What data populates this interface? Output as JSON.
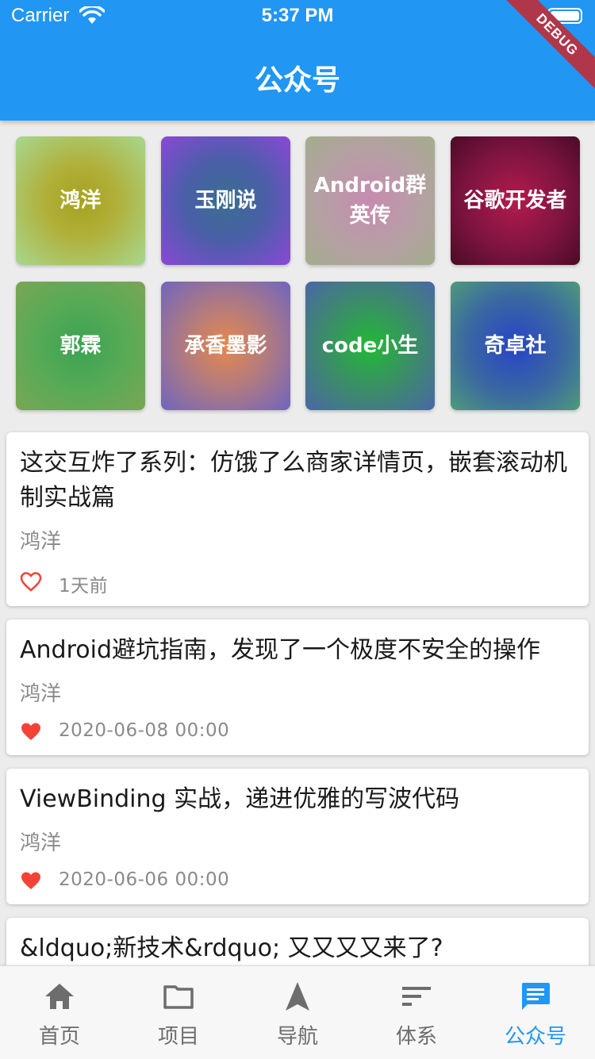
{
  "status_bar": {
    "carrier": "Carrier",
    "time": "5:37 PM",
    "debug_banner": "DEBUG"
  },
  "app_bar": {
    "title": "公众号"
  },
  "accounts": [
    {
      "name": "鸿洋"
    },
    {
      "name": "玉刚说"
    },
    {
      "name": "Android群英传"
    },
    {
      "name": "谷歌开发者"
    },
    {
      "name": "郭霖"
    },
    {
      "name": "承香墨影"
    },
    {
      "name": "code小生"
    },
    {
      "name": "奇卓社"
    }
  ],
  "articles": [
    {
      "title": "这交互炸了系列：仿饿了么商家详情页，嵌套滚动机制实战篇",
      "author": "鸿洋",
      "time": "1天前",
      "liked": false
    },
    {
      "title": "Android避坑指南，发现了一个极度不安全的操作",
      "author": "鸿洋",
      "time": "2020-06-08 00:00",
      "liked": true
    },
    {
      "title": "ViewBinding 实战，递进优雅的写波代码",
      "author": "鸿洋",
      "time": "2020-06-06 00:00",
      "liked": true
    },
    {
      "title": "&ldquo;新技术&rdquo; 又又又又来了?",
      "author": "",
      "time": "",
      "liked": false
    }
  ],
  "bottom_nav": {
    "active": "公众号",
    "items": [
      {
        "label": "首页",
        "icon": "home-icon"
      },
      {
        "label": "项目",
        "icon": "folder-icon"
      },
      {
        "label": "导航",
        "icon": "navigation-icon"
      },
      {
        "label": "体系",
        "icon": "sort-icon"
      },
      {
        "label": "公众号",
        "icon": "chat-icon"
      }
    ]
  },
  "colors": {
    "primary": "#2196f3",
    "like": "#f44336"
  }
}
